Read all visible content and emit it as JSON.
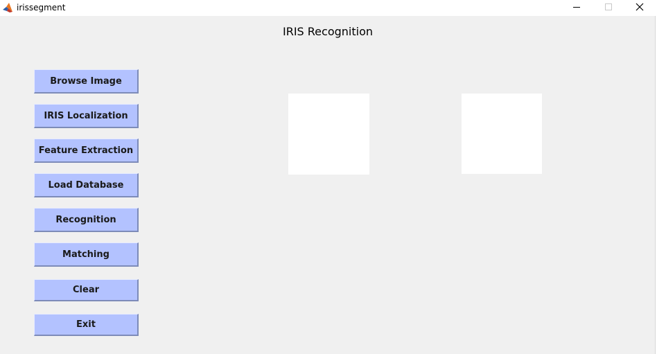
{
  "window": {
    "title": "irissegment"
  },
  "heading": "IRIS Recognition",
  "buttons": [
    {
      "id": "browse-image",
      "label": "Browse Image"
    },
    {
      "id": "iris-localization",
      "label": "IRIS Localization"
    },
    {
      "id": "feature-extraction",
      "label": "Feature Extraction"
    },
    {
      "id": "load-database",
      "label": "Load Database"
    },
    {
      "id": "recognition",
      "label": "Recognition"
    },
    {
      "id": "matching",
      "label": "Matching"
    },
    {
      "id": "clear",
      "label": "Clear"
    },
    {
      "id": "exit",
      "label": "Exit"
    }
  ],
  "colors": {
    "button_bg": "#b3c2ff",
    "window_bg": "#f0f0f0",
    "axes_bg": "#ffffff"
  },
  "icons": {
    "app": "matlab-logo-icon",
    "minimize": "minimize-icon",
    "maximize": "maximize-icon",
    "close": "close-icon"
  }
}
